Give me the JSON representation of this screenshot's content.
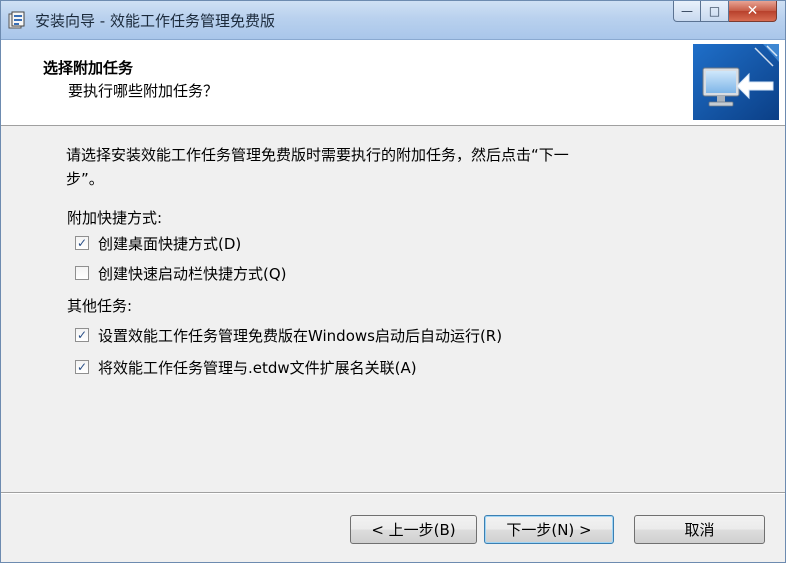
{
  "window": {
    "title": "安装向导 - 效能工作任务管理免费版",
    "controls": {
      "minimize": "—",
      "maximize": "□",
      "close": "✕"
    }
  },
  "header": {
    "title": "选择附加任务",
    "subtitle": "要执行哪些附加任务？",
    "image_icon": "computer-monitor-arrow-icon"
  },
  "content": {
    "intro_line1": "请选择安装效能工作任务管理免费版时需要执行的附加任务，然后点击“下一",
    "intro_line2": "步”。",
    "group_shortcuts": "附加快捷方式:",
    "group_other": "其他任务:",
    "tasks": [
      {
        "label": "创建桌面快捷方式(D)",
        "checked": true
      },
      {
        "label": "创建快速启动栏快捷方式(Q)",
        "checked": false
      },
      {
        "label": "设置效能工作任务管理免费版在Windows启动后自动运行(R)",
        "checked": true
      },
      {
        "label": "将效能工作任务管理与.etdw文件扩展名关联(A)",
        "checked": true
      }
    ]
  },
  "footer": {
    "back_label": "< 上一步(B)",
    "next_label": "下一步(N) >",
    "cancel_label": "取消"
  },
  "colors": {
    "titlebar": "#b9d1ee",
    "dialog_bg": "#f0f0f0",
    "header_bg": "#ffffff",
    "default_button_border": "#3c7fb1"
  }
}
